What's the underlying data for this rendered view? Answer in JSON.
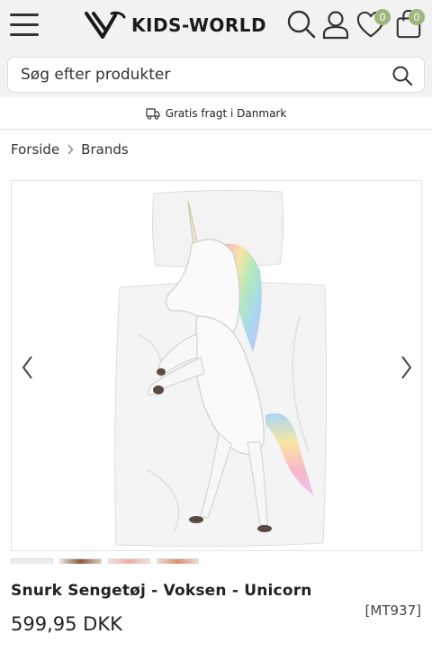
{
  "header": {
    "logo_text": "KIDS-WORLD",
    "wishlist_count": "0",
    "cart_count": "0",
    "accent_color": "#9bb77b"
  },
  "search": {
    "placeholder": "Søg efter produkter"
  },
  "shipping_banner": {
    "text": "Gratis fragt i Danmark",
    "icon": "truck-icon"
  },
  "breadcrumb": {
    "items": [
      "Forside",
      "Brands"
    ]
  },
  "product": {
    "title": "Snurk Sengetøj - Voksen - Unicorn",
    "sku": "[MT937]",
    "price": "599,95 DKK",
    "image": "unicorn-bedding-image",
    "thumbnail_count": 4
  }
}
